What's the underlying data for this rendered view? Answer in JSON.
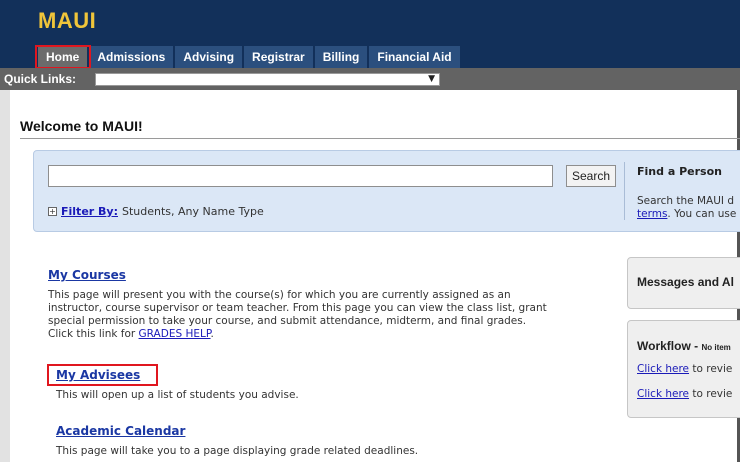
{
  "app": {
    "title": "MAUI"
  },
  "nav": {
    "tabs": [
      {
        "label": "Home",
        "active": true
      },
      {
        "label": "Admissions"
      },
      {
        "label": "Advising"
      },
      {
        "label": "Registrar"
      },
      {
        "label": "Billing"
      },
      {
        "label": "Financial Aid"
      }
    ]
  },
  "quick_links": {
    "label": "Quick Links:",
    "selected": ""
  },
  "welcome": {
    "title": "Welcome to MAUI!"
  },
  "search": {
    "button_label": "Search",
    "value": "",
    "filter_label": "Filter By:",
    "filter_value": "Students, Any Name Type"
  },
  "find_person": {
    "title": "Find a Person",
    "desc_line1": "Search the MAUI d",
    "desc_link": "terms",
    "desc_line2_rest": ". You can use"
  },
  "sections": {
    "courses": {
      "title": "My Courses",
      "desc_lines": [
        "This page will present you with the course(s) for which you are currently assigned as an",
        "instructor, course supervisor or team teacher. From this page you can view the class list, grant",
        "special permission to take your course, and submit attendance, midterm, and final grades."
      ],
      "desc_last_prefix": "Click this link for ",
      "desc_last_link": "GRADES HELP",
      "desc_last_suffix": "."
    },
    "advisees": {
      "title": "My Advisees",
      "desc": "This will open up a list of students you advise."
    },
    "calendar": {
      "title": "Academic Calendar",
      "desc": "This page will take you to a page displaying grade related deadlines."
    }
  },
  "messages": {
    "title": "Messages and Al"
  },
  "workflow": {
    "title": "Workflow -",
    "subtitle": "No item",
    "link1": "Click here",
    "rest1": " to revie",
    "link2": "Click here",
    "rest2": " to revie"
  },
  "colors": {
    "header_bg": "#12305a",
    "logo": "#f0c53a",
    "tab_bg": "#2b4f7e",
    "tab_active": "#6b6b6b",
    "quicklinks_bg": "#636363",
    "search_panel": "#dbe7f6",
    "link": "#1a37a3",
    "highlight": "#e0161f"
  }
}
